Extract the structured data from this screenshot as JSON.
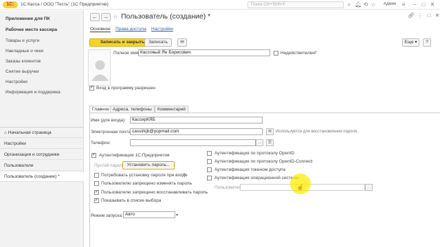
{
  "titlebar": {
    "logo": "1С:",
    "title": "1С:Касса / ООО \"Тесть\"  (1С:Предприятие)",
    "search_placeholder": "Поиск Ctrl+Shift+F",
    "user": "Админ"
  },
  "sidebar": {
    "sections": [
      {
        "label": "Приложение для ПК",
        "bold": true
      },
      {
        "label": "Рабочее место кассира",
        "bold": true
      },
      {
        "label": "Товары и услуги"
      },
      {
        "label": "Накладные и чеки"
      },
      {
        "label": "Заказы клиентов"
      },
      {
        "label": "Снятие выручки"
      },
      {
        "label": "Настройки"
      },
      {
        "label": "Информация и поддержка"
      }
    ],
    "open_windows": [
      {
        "label": "Начальная страница"
      },
      {
        "label": "Настройки"
      },
      {
        "label": "Организация и сотрудники"
      },
      {
        "label": "Пользователи"
      },
      {
        "label": "Пользователь (создание) *"
      }
    ]
  },
  "form": {
    "title": "Пользователь (создание) *",
    "tabs": [
      "Основное",
      "Права доступа",
      "Настройки"
    ],
    "buttons": {
      "save_close": "Записать и закрыть",
      "save": "Записать",
      "more": "Еще",
      "help": "?"
    },
    "full_name_label": "Полное имя:",
    "full_name_value": "Кассовый Ян Борисович",
    "invalid_label": "Недействителен",
    "login_allowed_label": "Вход в программу разрешен",
    "subtabs": [
      "Главное",
      "Адреса, телефоны",
      "Комментарий"
    ],
    "login_name_label": "Имя (для входа):",
    "login_name_value": "КассирКЯБ",
    "email_label": "Электронная почта:",
    "email_value": "cassirkjb@yopmail.com",
    "email_hint": "Используется для восстановления пароля.",
    "phone_label": "Телефон:",
    "auth_1c_label": "Аутентификация 1С:Предприятия",
    "empty_password": "Пустой пароль",
    "set_password_button": "Установить пароль...",
    "require_password_change": "Потребовать установку пароля при входе",
    "forbid_password_change": "Пользователю запрещено изменять пароль",
    "forbid_password_restore": "Пользователю запрещено восстанавливать пароль",
    "show_in_list": "Показывать в списке выбора",
    "auth_openid": "Аутентификация по протоколу OpenID",
    "auth_openid_connect": "Аутентификация по протоколу OpenID-Connect",
    "auth_token": "Аутентификация токеном доступа",
    "auth_os": "Аутентификация операционной системы",
    "os_user_label": "Пользователь:",
    "launch_mode_label": "Режим запуска:",
    "launch_mode_value": "Авто"
  },
  "colors": {
    "accent_button": "#f6d32d",
    "link": "#2a64b0",
    "cursor_highlight": "#ffec00"
  }
}
